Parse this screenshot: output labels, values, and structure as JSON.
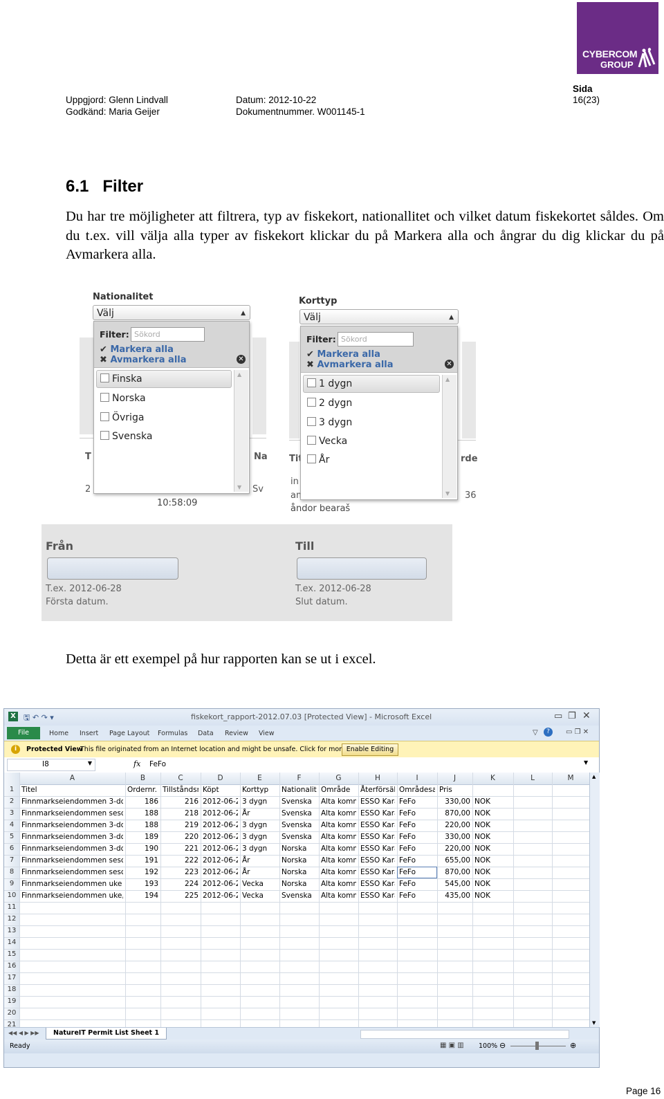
{
  "logo": {
    "line1": "CYBERCOM",
    "line2": "GROUP"
  },
  "header": {
    "uppgjord": "Uppgjord: Glenn Lindvall",
    "godkand": "Godkänd: Maria Geijer",
    "datum": "Datum: 2012-10-22",
    "dokumentnummer": "Dokumentnummer. W001145-1",
    "sida_label": "Sida",
    "sida_value": "16(23)"
  },
  "section": {
    "title": "6.1   Filter",
    "paragraph": "Du har tre möjligheter att filtrera, typ av fiskekort, nationallitet och vilket datum fiskekortet såldes. Om du t.ex. vill välja alla typer av fiskekort klickar du på Markera alla och ångrar du dig klickar du på Avmarkera alla."
  },
  "nationalitet_widget": {
    "label": "Nationalitet",
    "select_value": "Välj",
    "filter_label": "Filter:",
    "search_placeholder": "Sökord",
    "select_all": "Markera alla",
    "deselect_all": "Avmarkera alla",
    "options": [
      "Finska",
      "Norska",
      "Övriga",
      "Svenska"
    ],
    "bg_frag_t": "T",
    "bg_frag_na": "Na",
    "bg_frag_2": "2",
    "bg_frag_sv": "Sv",
    "bg_time": "10:58:09"
  },
  "korttyp_widget": {
    "label": "Korttyp",
    "select_value": "Välj",
    "filter_label": "Filter:",
    "search_placeholder": "Sökord",
    "select_all": "Markera alla",
    "deselect_all": "Avmarkera alla",
    "options": [
      "1 dygn",
      "2 dygn",
      "3 dygn",
      "Vecka",
      "År"
    ],
    "bg_frag_tit": "Tit",
    "bg_frag_rde": "rde",
    "bg_frag_in": "in",
    "bg_frag_am": "am",
    "bg_frag_36": "36",
    "bg_frag_andor": "åndor bearaš"
  },
  "date_widget": {
    "from_label": "Från",
    "to_label": "Till",
    "from_hint": "T.ex. 2012-06-28",
    "from_desc": "Första datum.",
    "to_hint": "T.ex. 2012-06-28",
    "to_desc": "Slut datum."
  },
  "excel_caption": "Detta är ett exempel på hur rapporten kan se ut i excel.",
  "excel": {
    "window_title": "fiskekort_rapport-2012.07.03  [Protected View]  -  Microsoft Excel",
    "tabs": [
      "File",
      "Home",
      "Insert",
      "Page Layout",
      "Formulas",
      "Data",
      "Review",
      "View"
    ],
    "protected_label": "Protected View",
    "protected_msg": "This file originated from an Internet location and might be unsafe. Click for more details.",
    "enable_button": "Enable Editing",
    "name_box": "I8",
    "fx": "fx",
    "formula_value": "FeFo",
    "columns": [
      "A",
      "B",
      "C",
      "D",
      "E",
      "F",
      "G",
      "H",
      "I",
      "J",
      "K",
      "L",
      "M"
    ],
    "rows": [
      [
        "Titel",
        "Ordernr.",
        "Tillståndsn",
        "Köpt",
        "Korttyp",
        "Nationalit",
        "Område",
        "Återförsälj",
        "Områdesa",
        "Pris",
        ""
      ],
      [
        "Finnmarkseiendommen 3-dc",
        "186",
        "216",
        "2012-06-2",
        "3 dygn",
        "Svenska",
        "Alta komm",
        "ESSO Kara",
        "FeFo",
        "330,00",
        "NOK"
      ],
      [
        "Finnmarkseiendommen sesc",
        "188",
        "218",
        "2012-06-2",
        "År",
        "Svenska",
        "Alta komm",
        "ESSO Kara",
        "FeFo",
        "870,00",
        "NOK"
      ],
      [
        "Finnmarkseiendommen 3-dc",
        "188",
        "219",
        "2012-06-2",
        "3 dygn",
        "Svenska",
        "Alta komm",
        "ESSO Kara",
        "FeFo",
        "220,00",
        "NOK"
      ],
      [
        "Finnmarkseiendommen 3-dc",
        "189",
        "220",
        "2012-06-2",
        "3 dygn",
        "Svenska",
        "Alta komm",
        "ESSO Kara",
        "FeFo",
        "330,00",
        "NOK"
      ],
      [
        "Finnmarkseiendommen 3-dc",
        "190",
        "221",
        "2012-06-2",
        "3 dygn",
        "Norska",
        "Alta komm",
        "ESSO Kara",
        "FeFo",
        "220,00",
        "NOK"
      ],
      [
        "Finnmarkseiendommen sesc",
        "191",
        "222",
        "2012-06-2",
        "År",
        "Norska",
        "Alta komm",
        "ESSO Kara",
        "FeFo",
        "655,00",
        "NOK"
      ],
      [
        "Finnmarkseiendommen sesc",
        "192",
        "223",
        "2012-06-2",
        "År",
        "Norska",
        "Alta komm",
        "ESSO Kara",
        "FeFo",
        "870,00",
        "NOK"
      ],
      [
        "Finnmarkseiendommen uke",
        "193",
        "224",
        "2012-06-2",
        "Vecka",
        "Norska",
        "Alta komm",
        "ESSO Kara",
        "FeFo",
        "545,00",
        "NOK"
      ],
      [
        "Finnmarkseiendommen uke,",
        "194",
        "225",
        "2012-06-2",
        "Vecka",
        "Svenska",
        "Alta komm",
        "ESSO Kara",
        "FeFo",
        "435,00",
        "NOK"
      ]
    ],
    "row_numbers": [
      "1",
      "2",
      "3",
      "4",
      "5",
      "6",
      "7",
      "8",
      "9",
      "10",
      "11",
      "12",
      "13",
      "14",
      "15",
      "16",
      "17",
      "18",
      "19",
      "20",
      "21"
    ],
    "sheet_tab": "NatureIT Permit List Sheet 1",
    "status": "Ready",
    "zoom": "100%"
  },
  "footer": {
    "page": "Page 16"
  }
}
